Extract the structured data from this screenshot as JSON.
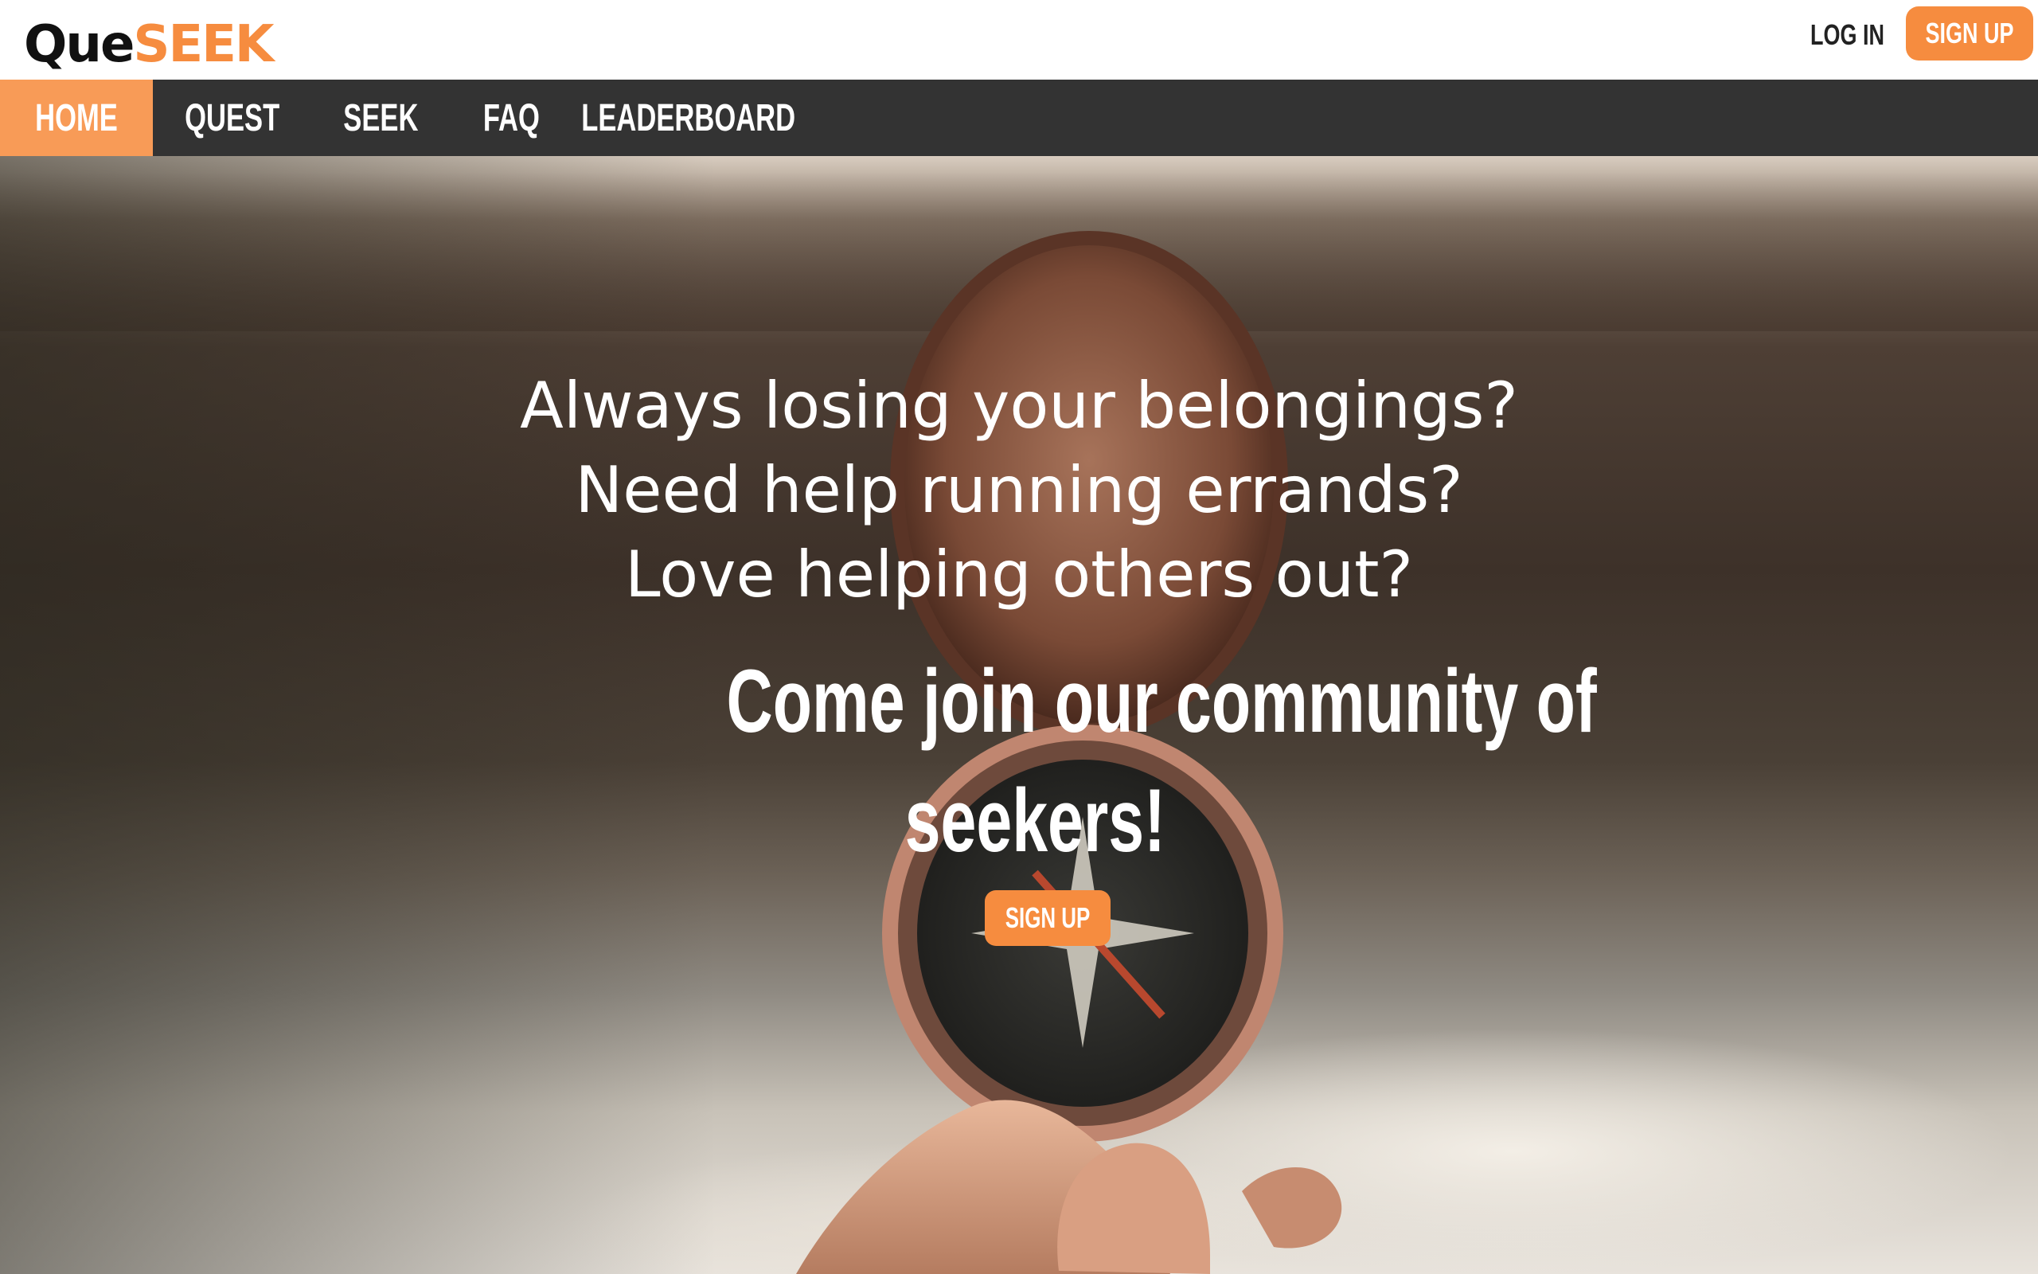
{
  "brand": {
    "logo_part1": "Que",
    "logo_part2": "SEEK",
    "accent_color": "#f68c3f",
    "nav_bg": "#333333"
  },
  "header": {
    "login_label": "LOG IN",
    "signup_label": "SIGN UP"
  },
  "nav": {
    "items": [
      {
        "label": "HOME",
        "active": true
      },
      {
        "label": "QUEST"
      },
      {
        "label": "SEEK"
      },
      {
        "label": "FAQ"
      },
      {
        "label": "LEADERBOARD"
      }
    ]
  },
  "hero": {
    "questions": [
      "Always losing your belongings?",
      "Need help running errands?",
      "Love helping others out?"
    ],
    "headline_line1": "Come join our community of",
    "headline_line2": "seekers!",
    "cta_label": "SIGN UP",
    "background_image": "hand-holding-compass-photo"
  }
}
